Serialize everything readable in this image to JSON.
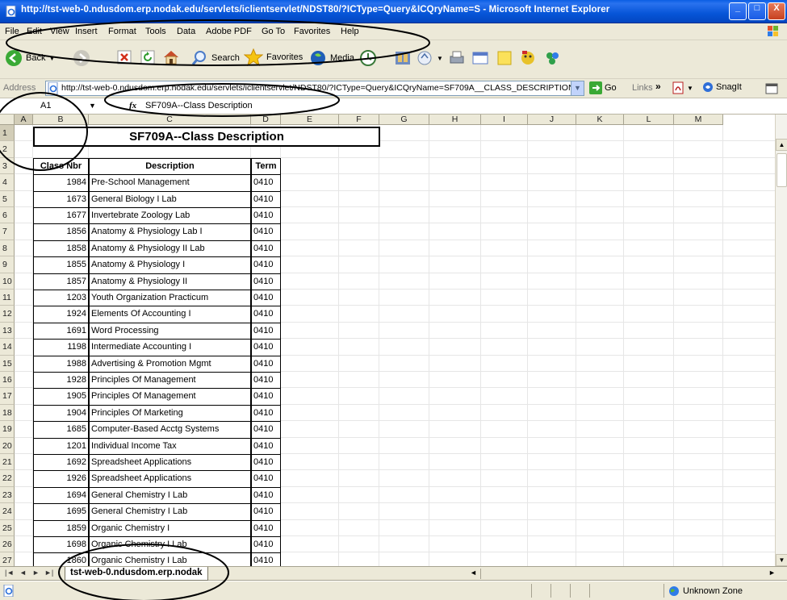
{
  "window": {
    "title": "http://tst-web-0.ndusdom.erp.nodak.edu/servlets/iclientservlet/NDST80/?ICType=Query&ICQryName=S - Microsoft Internet Explorer",
    "controls": {
      "minimize": "_",
      "maximize": "□",
      "close": "X"
    }
  },
  "menu": {
    "items": [
      "File",
      "Edit",
      "View",
      "Insert",
      "Format",
      "Tools",
      "Data",
      "Adobe PDF",
      "Go To",
      "Favorites",
      "Help"
    ]
  },
  "toolbar": {
    "back": "Back",
    "search": "Search",
    "favorites": "Favorites",
    "media": "Media"
  },
  "address": {
    "label": "Address",
    "url": "http://tst-web-0.ndusdom.erp.nodak.edu/servlets/iclientservlet/NDST80/?ICType=Query&ICQryName=SF709A__CLASS_DESCRIPTION",
    "go": "Go",
    "links": "Links",
    "links_chevron": "»",
    "snagit": "SnagIt"
  },
  "formula": {
    "cell_ref": "A1",
    "fx": "fx",
    "content": "SF709A--Class Description"
  },
  "sheet": {
    "columns": [
      "A",
      "B",
      "C",
      "D",
      "E",
      "F",
      "G",
      "H",
      "I",
      "J",
      "K",
      "L",
      "M"
    ],
    "title": "SF709A--Class Description",
    "headers": {
      "class_nbr": "Class Nbr",
      "description": "Description",
      "term": "Term"
    },
    "row_numbers": [
      "1",
      "2",
      "3",
      "4",
      "5",
      "6",
      "7",
      "8",
      "9",
      "10",
      "11",
      "12",
      "13",
      "14",
      "15",
      "16",
      "17",
      "18",
      "19",
      "20",
      "21",
      "22",
      "23",
      "24",
      "25",
      "26",
      "27"
    ],
    "rows": [
      {
        "nbr": "1984",
        "desc": "Pre-School Management",
        "term": "0410"
      },
      {
        "nbr": "1673",
        "desc": "General Biology I Lab",
        "term": "0410"
      },
      {
        "nbr": "1677",
        "desc": "Invertebrate Zoology Lab",
        "term": "0410"
      },
      {
        "nbr": "1856",
        "desc": "Anatomy & Physiology Lab I",
        "term": "0410"
      },
      {
        "nbr": "1858",
        "desc": "Anatomy & Physiology II Lab",
        "term": "0410"
      },
      {
        "nbr": "1855",
        "desc": "Anatomy & Physiology I",
        "term": "0410"
      },
      {
        "nbr": "1857",
        "desc": "Anatomy & Physiology II",
        "term": "0410"
      },
      {
        "nbr": "1203",
        "desc": "Youth Organization Practicum",
        "term": "0410"
      },
      {
        "nbr": "1924",
        "desc": "Elements Of Accounting I",
        "term": "0410"
      },
      {
        "nbr": "1691",
        "desc": "Word Processing",
        "term": "0410"
      },
      {
        "nbr": "1198",
        "desc": "Intermediate Accounting I",
        "term": "0410"
      },
      {
        "nbr": "1988",
        "desc": "Advertising & Promotion Mgmt",
        "term": "0410"
      },
      {
        "nbr": "1928",
        "desc": "Principles Of Management",
        "term": "0410"
      },
      {
        "nbr": "1905",
        "desc": "Principles Of Management",
        "term": "0410"
      },
      {
        "nbr": "1904",
        "desc": "Principles Of Marketing",
        "term": "0410"
      },
      {
        "nbr": "1685",
        "desc": "Computer-Based Acctg Systems",
        "term": "0410"
      },
      {
        "nbr": "1201",
        "desc": "Individual Income Tax",
        "term": "0410"
      },
      {
        "nbr": "1692",
        "desc": "Spreadsheet Applications",
        "term": "0410"
      },
      {
        "nbr": "1926",
        "desc": "Spreadsheet Applications",
        "term": "0410"
      },
      {
        "nbr": "1694",
        "desc": "General Chemistry I Lab",
        "term": "0410"
      },
      {
        "nbr": "1695",
        "desc": "General Chemistry I Lab",
        "term": "0410"
      },
      {
        "nbr": "1859",
        "desc": "Organic Chemistry I",
        "term": "0410"
      },
      {
        "nbr": "1698",
        "desc": "Organic Chemistry I Lab",
        "term": "0410"
      },
      {
        "nbr": "1860",
        "desc": "Organic Chemistry I Lab",
        "term": "0410"
      }
    ],
    "tab_name": "tst-web-0.ndusdom.erp.nodak",
    "tab_nav": [
      "|◄",
      "◄",
      "►",
      "►|"
    ]
  },
  "status": {
    "zone": "Unknown Zone"
  },
  "colors": {
    "titlebar": "#0655d8",
    "chrome": "#ece9d8",
    "annotation": "#000000"
  },
  "icons": [
    "ie-page-icon",
    "back-arrow-icon",
    "forward-arrow-icon",
    "stop-icon",
    "refresh-icon",
    "home-icon",
    "search-icon",
    "favorites-star-icon",
    "media-icon",
    "history-icon",
    "mail-icon",
    "print-icon",
    "edit-icon",
    "windows-logo-icon"
  ]
}
